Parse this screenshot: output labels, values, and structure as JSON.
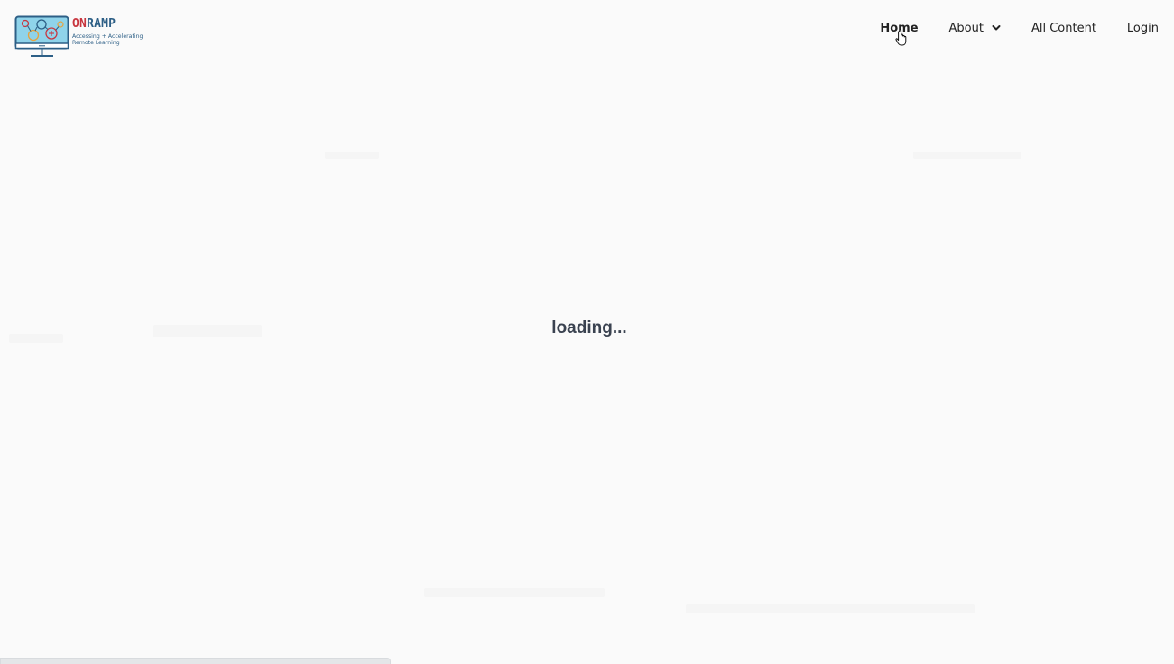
{
  "brand": {
    "name_part1": "ON",
    "name_part2": "RAMP",
    "tagline": "Accessing + Accelerating Remote Learning",
    "colors": {
      "red": "#c8363f",
      "blue": "#2d5f86",
      "screen": "#8fd3ea"
    }
  },
  "nav": {
    "items": [
      {
        "label": "Home",
        "active": true
      },
      {
        "label": "About",
        "has_dropdown": true
      },
      {
        "label": "All Content"
      },
      {
        "label": "Login"
      }
    ]
  },
  "main": {
    "status_text": "loading..."
  },
  "icons": {
    "logo": "computer-monitor-logo-icon",
    "dropdown": "chevron-down-icon",
    "cursor": "hand-pointer-cursor-icon"
  }
}
